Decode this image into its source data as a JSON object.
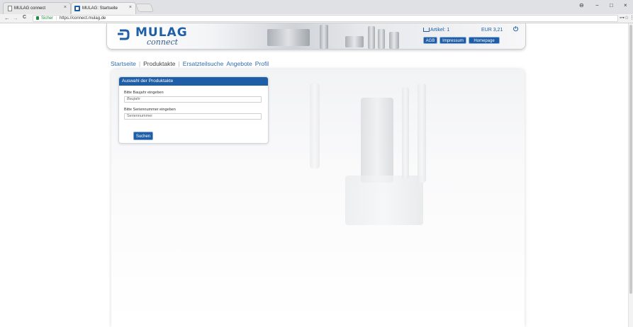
{
  "browser": {
    "tabs": [
      {
        "label": "MULAG connect",
        "close": "×",
        "active": false
      },
      {
        "label": "MULAG: Startseite",
        "close": "×",
        "active": true
      }
    ],
    "window_controls": {
      "user": "⊖",
      "minimize": "−",
      "maximize": "□",
      "close": "×"
    },
    "nav": {
      "back": "←",
      "forward": "→",
      "reload": "C"
    },
    "address": {
      "security": "Sicher",
      "separator": "|",
      "url": "https://connect.mulag.de"
    },
    "right_icons": {
      "key": "⊶",
      "star": "☆",
      "menu": "⋮"
    }
  },
  "header": {
    "logo_text": "MULAG",
    "logo_sub": "connect",
    "cart_label": "Artikel: 1",
    "price": "EUR 3,21",
    "power_icon": "⏻",
    "buttons": [
      "AGB",
      "Impressum",
      "Homepage"
    ]
  },
  "menu": {
    "items": [
      "Startseite",
      "Produktakte",
      "Ersatzteilsuche",
      "Angebote",
      "Profil"
    ],
    "active_index": 1
  },
  "panel": {
    "title": "Auswahl der Produktakte",
    "field1_label": "Bitte Baujahr eingeben",
    "field1_placeholder": "Baujahr",
    "field2_label": "Bitte Seriennummer eingeben",
    "field2_placeholder": "Seriennummer",
    "submit": "Suchen"
  },
  "colors": {
    "brand_blue": "#1e5ea6",
    "link_blue": "#2d6bb0"
  }
}
